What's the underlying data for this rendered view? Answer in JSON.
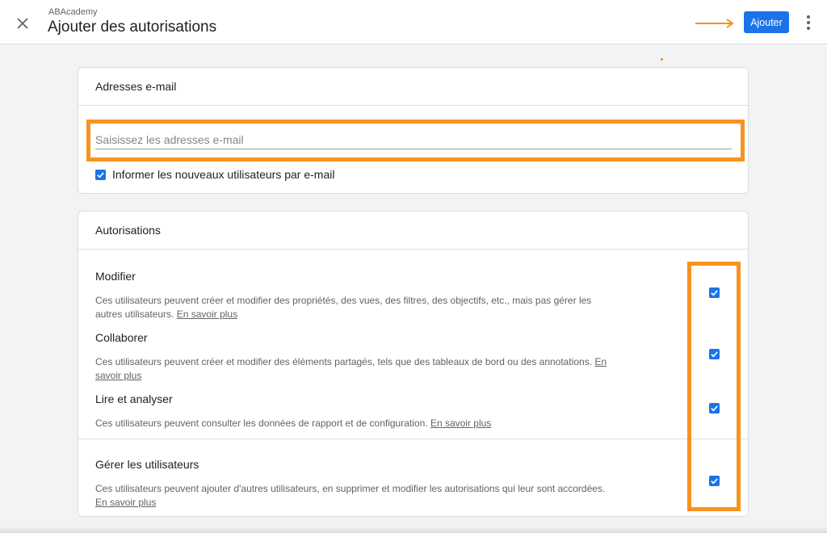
{
  "header": {
    "account_name": "ABAcademy",
    "title": "Ajouter des autorisations",
    "add_label": "Ajouter",
    "close_icon": "close-icon",
    "more_icon": "more-vert-icon"
  },
  "email_section": {
    "title": "Adresses e-mail",
    "placeholder": "Saisissez les adresses e-mail",
    "value": "",
    "notify_label": "Informer les nouveaux utilisateurs par e-mail",
    "notify_checked": true
  },
  "permissions_section": {
    "title": "Autorisations",
    "learn_more": "En savoir plus",
    "items": [
      {
        "title": "Modifier",
        "description": "Ces utilisateurs peuvent créer et modifier des propriétés, des vues, des filtres, des objectifs, etc., mais pas gérer les autres utilisateurs.",
        "checked": true
      },
      {
        "title": "Collaborer",
        "description": "Ces utilisateurs peuvent créer et modifier des éléments partagés, tels que des tableaux de bord ou des annotations.",
        "checked": true
      },
      {
        "title": "Lire et analyser",
        "description": "Ces utilisateurs peuvent consulter les données de rapport et de configuration.",
        "checked": true
      },
      {
        "title": "Gérer les utilisateurs",
        "description": "Ces utilisateurs peuvent ajouter d'autres utilisateurs, en supprimer et modifier les autorisations qui leur sont accordées.",
        "checked": true
      }
    ]
  },
  "colors": {
    "accent": "#1a73e8",
    "highlight": "#f7931e"
  }
}
